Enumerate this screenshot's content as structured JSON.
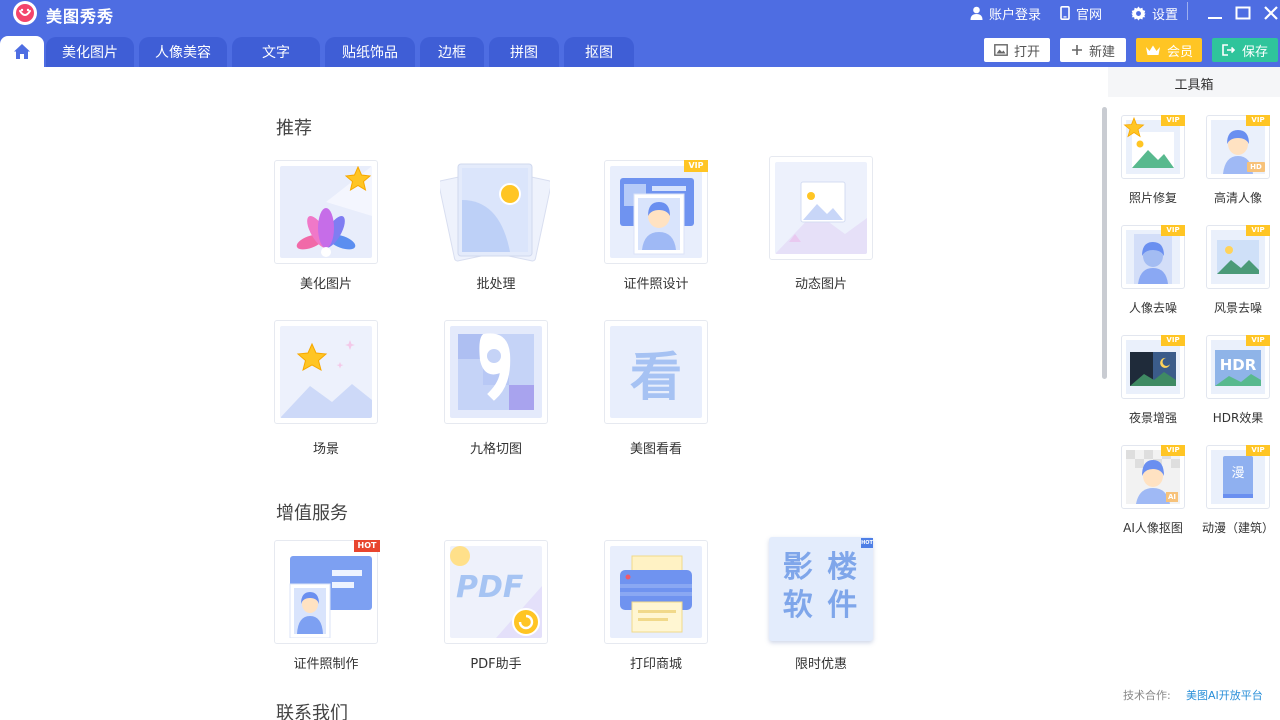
{
  "app": {
    "title": "美图秀秀"
  },
  "top_links": {
    "account": "账户登录",
    "website": "官网",
    "settings": "设置"
  },
  "tabs": [
    "美化图片",
    "人像美容",
    "文字",
    "贴纸饰品",
    "边框",
    "拼图",
    "抠图"
  ],
  "actions": {
    "open": "打开",
    "new": "新建",
    "vip": "会员",
    "save": "保存"
  },
  "sections": {
    "recommend": {
      "title": "推荐",
      "items": [
        "美化图片",
        "批处理",
        "证件照设计",
        "动态图片",
        "场景",
        "九格切图",
        "美图看看"
      ]
    },
    "services": {
      "title": "增值服务",
      "items": [
        "证件照制作",
        "PDF助手",
        "打印商城",
        "限时优惠"
      ]
    },
    "contact": {
      "title": "联系我们"
    }
  },
  "tags": {
    "vip": "VIP",
    "hot": "HOT",
    "pdf": "PDF",
    "look": "看",
    "promo_line1": "影 楼",
    "promo_line2": "软 件",
    "hd": "HD",
    "hdr": "HDR",
    "ai": "AI",
    "manga": "漫"
  },
  "toolbox": {
    "title": "工具箱",
    "items": [
      "照片修复",
      "高清人像",
      "人像去噪",
      "风景去噪",
      "夜景增强",
      "HDR效果",
      "AI人像抠图",
      "动漫（建筑）"
    ]
  },
  "footer": {
    "tech_label": "技术合作:",
    "tech_link": "美图AI开放平台"
  },
  "colors": {
    "header": "#4e6de2",
    "tab": "#3f5ed6",
    "vip": "#ffc524",
    "save": "#2fc49b",
    "hot": "#e8452f"
  }
}
